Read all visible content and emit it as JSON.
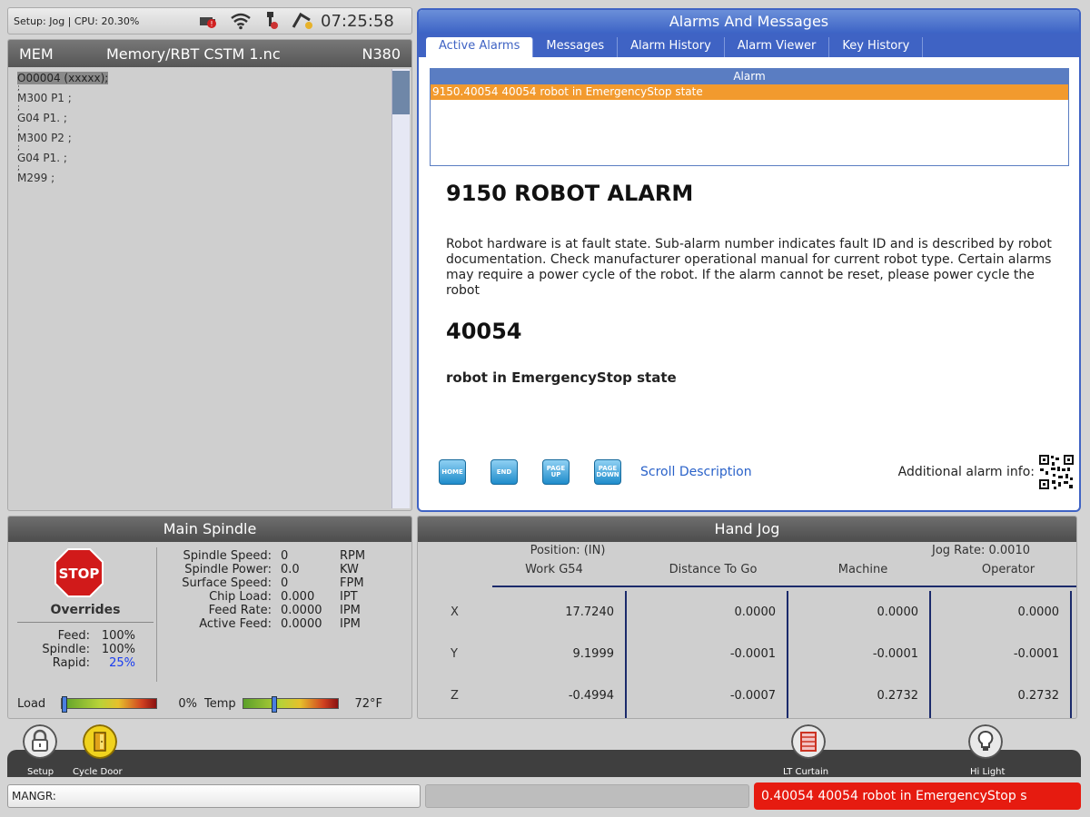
{
  "status_bar": {
    "text": "Setup: Jog | CPU: 20.30%",
    "clock": "07:25:58",
    "icons": [
      "alarm-battery-icon",
      "wifi-icon",
      "probe-icon",
      "toolchanger-icon"
    ]
  },
  "program": {
    "mode": "MEM",
    "file": "Memory/RBT CSTM 1.nc",
    "line_no": "N380",
    "lines": [
      {
        "text": "O00004 (xxxxx);",
        "kind": "hl"
      },
      {
        "text": ";",
        "kind": "sep"
      },
      {
        "text": "M300 P1 ;",
        "kind": "code"
      },
      {
        "text": ";",
        "kind": "sep"
      },
      {
        "text": "G04 P1. ;",
        "kind": "code"
      },
      {
        "text": ";",
        "kind": "sep"
      },
      {
        "text": "M300 P2 ;",
        "kind": "code"
      },
      {
        "text": ";",
        "kind": "sep"
      },
      {
        "text": "G04 P1. ;",
        "kind": "code"
      },
      {
        "text": ";",
        "kind": "sep"
      },
      {
        "text": "M299 ;",
        "kind": "code"
      }
    ]
  },
  "alarms": {
    "title": "Alarms And Messages",
    "tabs": [
      "Active Alarms",
      "Messages",
      "Alarm History",
      "Alarm Viewer",
      "Key History"
    ],
    "active_tab": 0,
    "list_header": "Alarm",
    "rows": [
      "9150.40054 40054 robot in EmergencyStop state"
    ],
    "heading": "9150 ROBOT ALARM",
    "description": "Robot hardware is at fault state. Sub-alarm number indicates fault ID and is described by robot documentation. Check manufacturer operational manual for current robot type. Certain alarms may require a power cycle of the robot. If the alarm cannot be reset, please power cycle the robot",
    "code": "40054",
    "sub_description": "robot in EmergencyStop state",
    "keys": [
      "HOME",
      "END",
      "PAGE UP",
      "PAGE DOWN"
    ],
    "scroll_label": "Scroll Description",
    "additional_info_label": "Additional alarm info:"
  },
  "spindle": {
    "title": "Main Spindle",
    "stop_label": "STOP",
    "overrides_title": "Overrides",
    "overrides": [
      {
        "label": "Feed:",
        "value": "100%"
      },
      {
        "label": "Spindle:",
        "value": "100%"
      },
      {
        "label": "Rapid:",
        "value": "25%"
      }
    ],
    "stats": [
      {
        "label": "Spindle Speed:",
        "value": "0",
        "unit": "RPM"
      },
      {
        "label": "Spindle Power:",
        "value": "0.0",
        "unit": "KW"
      },
      {
        "label": "Surface Speed:",
        "value": "0",
        "unit": "FPM"
      },
      {
        "label": "Chip Load:",
        "value": "0.000",
        "unit": "IPT"
      },
      {
        "label": "Feed Rate:",
        "value": "0.0000",
        "unit": "IPM"
      },
      {
        "label": "Active Feed:",
        "value": "0.0000",
        "unit": "IPM"
      }
    ],
    "load_label": "Load",
    "load_value": "0%",
    "load_fraction": 0.0,
    "temp_label": "Temp",
    "temp_value": "72°F",
    "temp_fraction": 0.3
  },
  "jog": {
    "title": "Hand Jog",
    "position_label": "Position: (IN)",
    "jog_rate": "Jog Rate: 0.0010",
    "columns": [
      "Work G54",
      "Distance To Go",
      "Machine",
      "Operator"
    ],
    "axes": [
      {
        "axis": "X",
        "values": [
          "17.7240",
          "0.0000",
          "0.0000",
          "0.0000"
        ]
      },
      {
        "axis": "Y",
        "values": [
          "9.1999",
          "-0.0001",
          "-0.0001",
          "-0.0001"
        ]
      },
      {
        "axis": "Z",
        "values": [
          "-0.4994",
          "-0.0007",
          "0.2732",
          "0.2732"
        ]
      }
    ]
  },
  "bottom": {
    "buttons": [
      {
        "label": "Setup",
        "icon": "padlock-icon"
      },
      {
        "label": "Cycle Door",
        "icon": "door-icon"
      },
      {
        "label": "LT Curtain",
        "icon": "light-curtain-icon"
      },
      {
        "label": "Hi Light",
        "icon": "lightbulb-icon"
      }
    ],
    "input_label": "MANGR:",
    "ticker": "0.40054 40054 robot in EmergencyStop s"
  },
  "colors": {
    "accent_blue": "#3f63c4",
    "alarm_row": "#f29a2e",
    "alarm_ticker": "#e61b10",
    "stop_red": "#d11a1a"
  }
}
